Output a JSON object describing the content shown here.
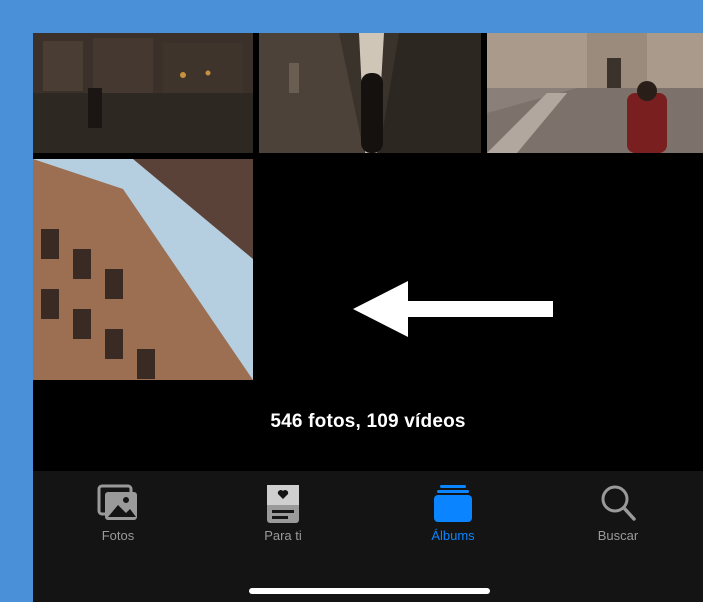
{
  "frame": {
    "border_color": "#4a90d9"
  },
  "photos": [
    {
      "description_icon": "street-night-photo"
    },
    {
      "description_icon": "alley-photo"
    },
    {
      "description_icon": "plaza-photo"
    },
    {
      "description_icon": "building-photo"
    }
  ],
  "overlay": {
    "arrow_icon": "left-arrow-icon",
    "arrow_color": "#ffffff"
  },
  "library": {
    "count_text": "546 fotos, 109 vídeos"
  },
  "tabbar": {
    "active_color": "#0a84ff",
    "inactive_color": "#9a9a9a",
    "tabs": [
      {
        "label": "Fotos",
        "icon": "photos-icon",
        "active": false
      },
      {
        "label": "Para ti",
        "icon": "for-you-icon",
        "active": false
      },
      {
        "label": "Álbums",
        "icon": "albums-icon",
        "active": true
      },
      {
        "label": "Buscar",
        "icon": "search-icon",
        "active": false
      }
    ]
  }
}
